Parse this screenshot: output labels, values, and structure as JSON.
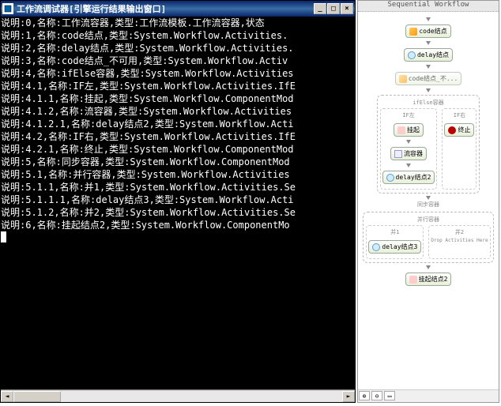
{
  "window": {
    "title": "工作流调试器[引擎运行结果输出窗口]",
    "buttons": {
      "min": "_",
      "max": "□",
      "close": "×"
    }
  },
  "console_lines": [
    "说明:0,名称:工作流容器,类型:工作流模板.工作流容器,状态",
    "说明:1,名称:code结点,类型:System.Workflow.Activities.",
    "说明:2,名称:delay结点,类型:System.Workflow.Activities.",
    "说明:3,名称:code结点_不可用,类型:System.Workflow.Activ",
    "说明:4,名称:ifElse容器,类型:System.Workflow.Activities",
    "说明:4.1,名称:IF左,类型:System.Workflow.Activities.IfE",
    "说明:4.1.1,名称:挂起,类型:System.Workflow.ComponentMod",
    "说明:4.1.2,名称:流容器,类型:System.Workflow.Activities",
    "说明:4.1.2.1,名称:delay结点2,类型:System.Workflow.Acti",
    "说明:4.2,名称:IF右,类型:System.Workflow.Activities.IfE",
    "说明:4.2.1,名称:终止,类型:System.Workflow.ComponentMod",
    "说明:5,名称:同步容器,类型:System.Workflow.ComponentMod",
    "说明:5.1,名称:并行容器,类型:System.Workflow.Activities",
    "说明:5.1.1,名称:并1,类型:System.Workflow.Activities.Se",
    "说明:5.1.1.1,名称:delay结点3,类型:System.Workflow.Acti",
    "说明:5.1.2,名称:并2,类型:System.Workflow.Activities.Se",
    "说明:6,名称:挂起结点2,类型:System.Workflow.ComponentMo"
  ],
  "designer": {
    "header": "Sequential Workflow",
    "nodes": {
      "code1": "code结点",
      "delay1": "delay结点",
      "code2": "code结点_不...",
      "ifelse": "ifElse容器",
      "ifl": "IF左",
      "ifr": "IF右",
      "susp1": "挂起",
      "seq": "流容器",
      "delay2": "delay结点2",
      "term": "终止",
      "sync": "同步容器",
      "parallel": "并行容器",
      "p1": "并1",
      "p2": "并2",
      "delay3": "delay结点3",
      "drop": "Drop Activities Here",
      "susp2": "挂起结点2"
    }
  },
  "scroll": {
    "left": "◄",
    "right": "►"
  }
}
